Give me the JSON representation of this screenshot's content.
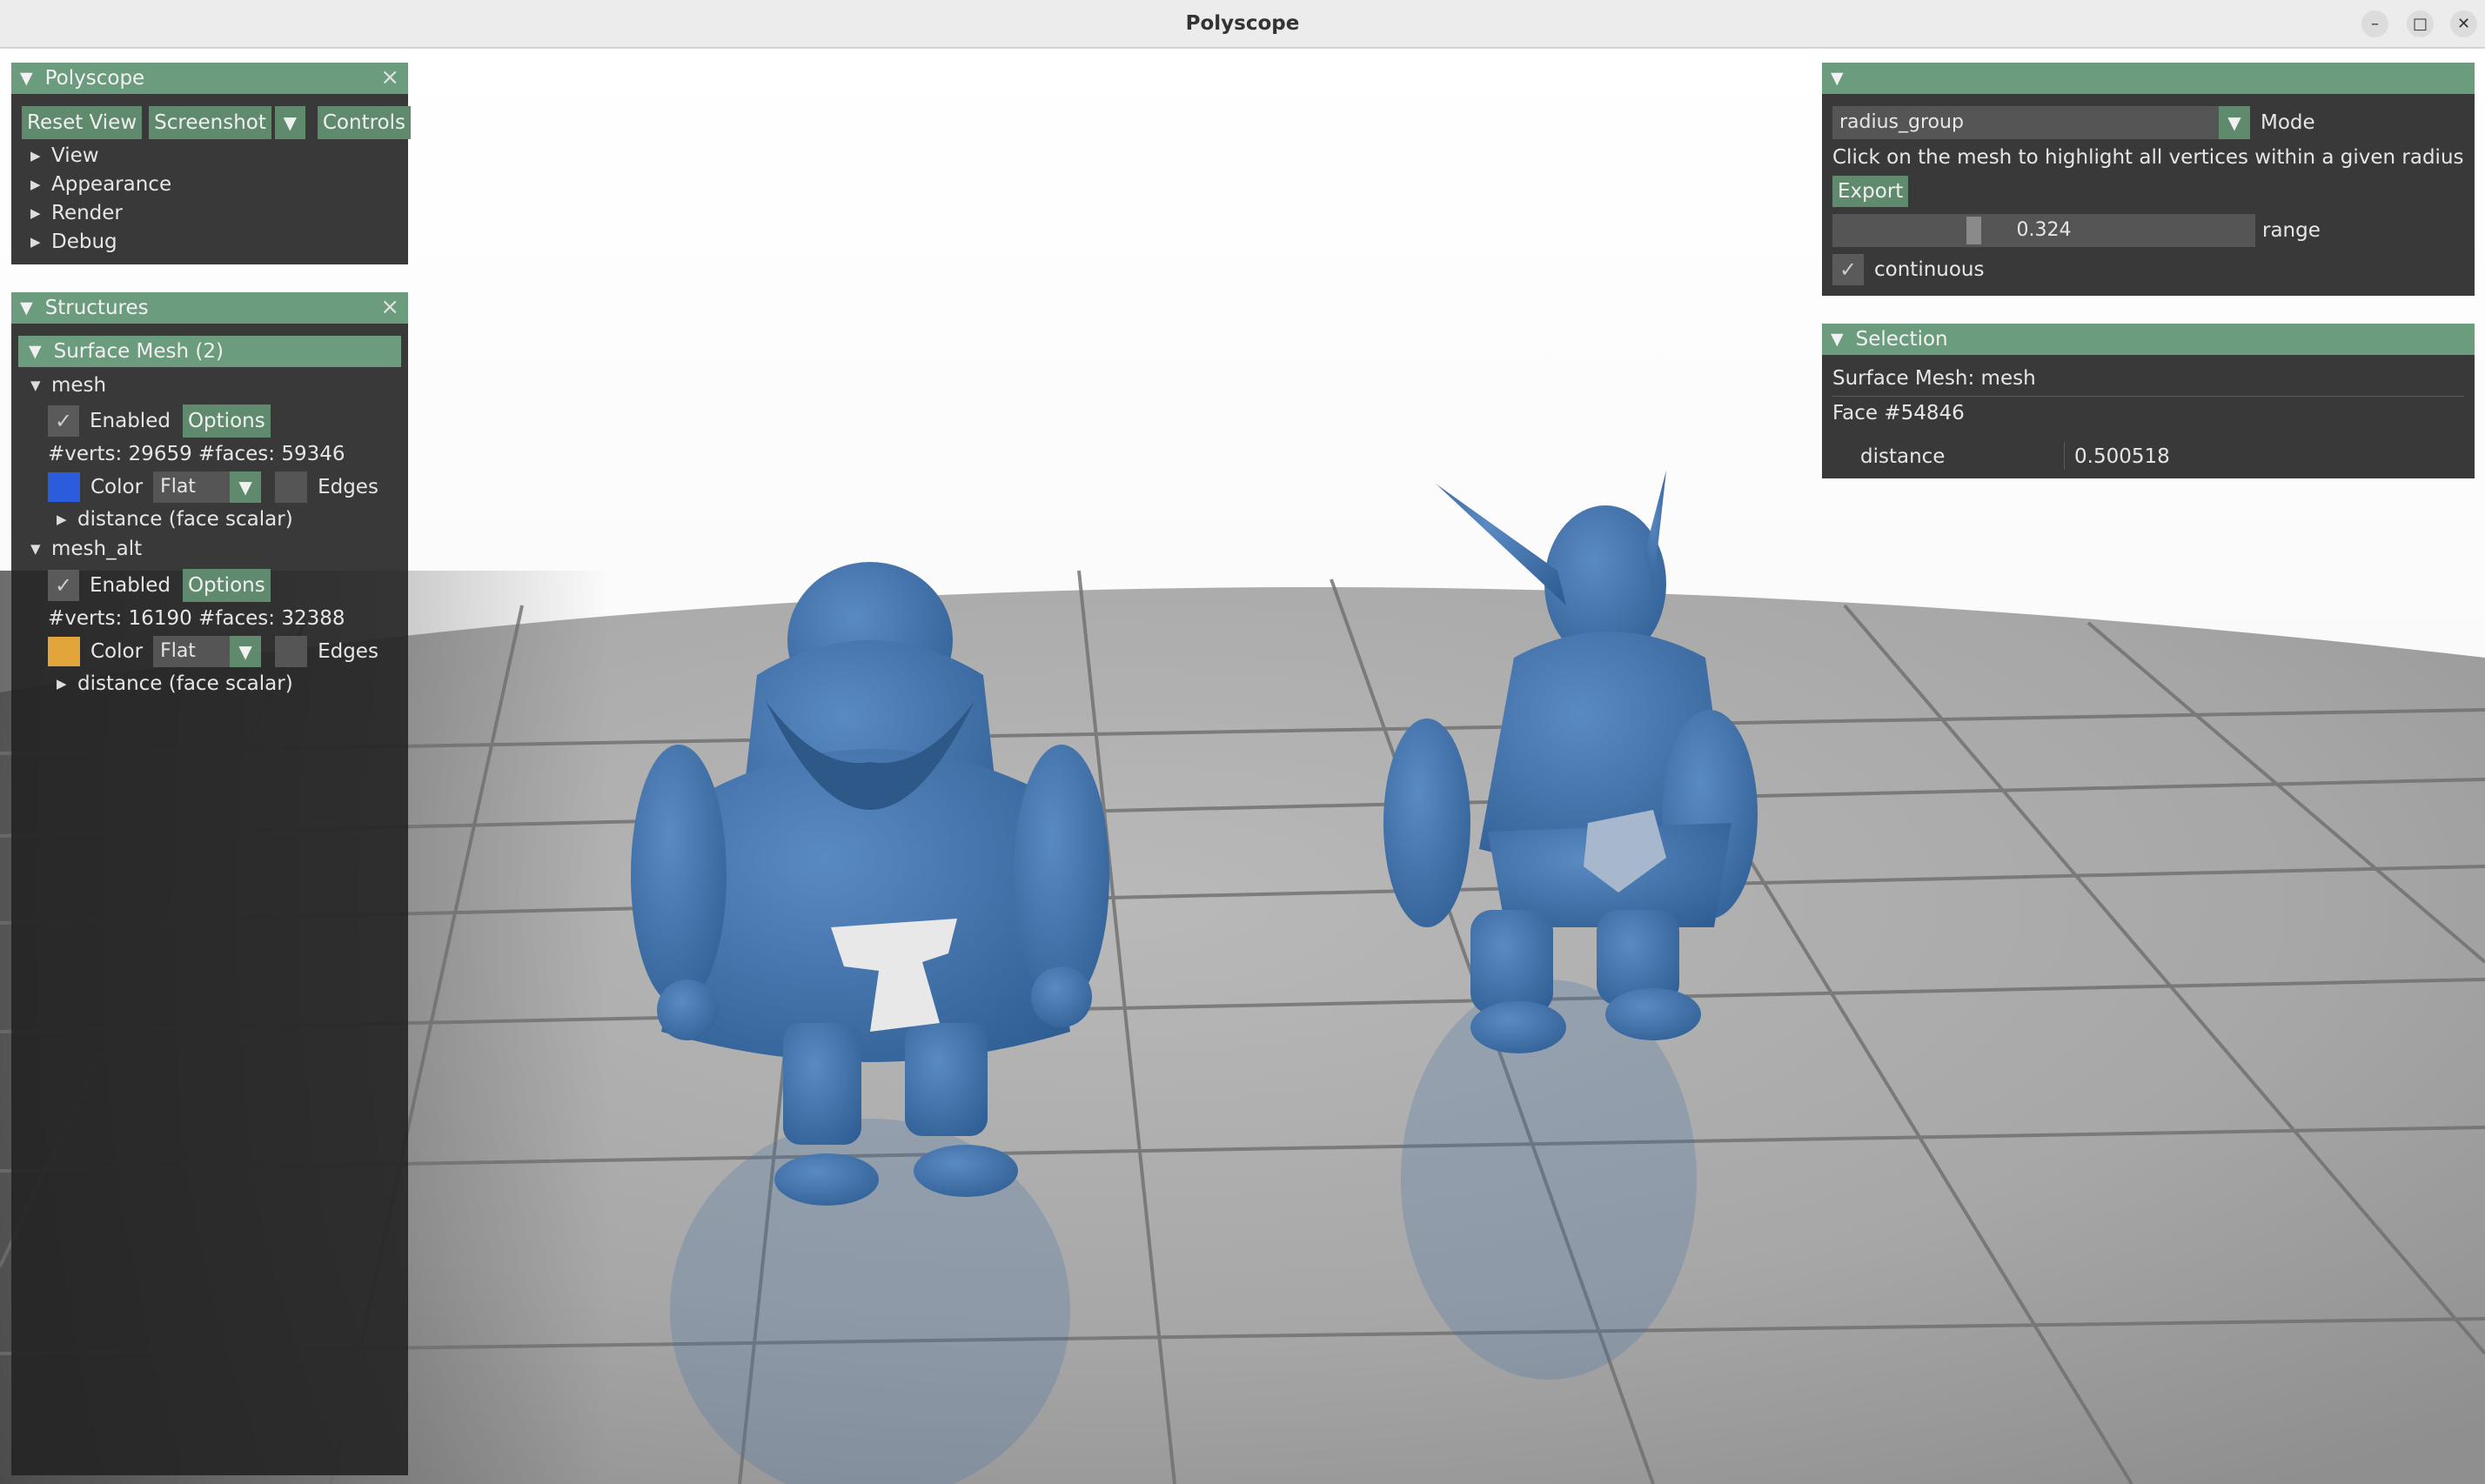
{
  "window": {
    "title": "Polyscope",
    "controls": {
      "minimize": "–",
      "maximize": "□",
      "close": "✕"
    }
  },
  "polyscope_panel": {
    "title": "Polyscope",
    "buttons": {
      "reset_view": "Reset View",
      "screenshot": "Screenshot",
      "controls": "Controls"
    },
    "menu": [
      "View",
      "Appearance",
      "Render",
      "Debug"
    ]
  },
  "structures_panel": {
    "title": "Structures",
    "group": "Surface Mesh (2)",
    "meshes": [
      {
        "name": "mesh",
        "enabled_label": "Enabled",
        "options_label": "Options",
        "stats": "#verts: 29659  #faces: 59346",
        "color": "#2a5cdc",
        "color_label": "Color",
        "shade": "Flat",
        "edges_label": "Edges",
        "quantity": "distance (face scalar)"
      },
      {
        "name": "mesh_alt",
        "enabled_label": "Enabled",
        "options_label": "Options",
        "stats": "#verts: 16190  #faces: 32388",
        "color": "#e2a53b",
        "color_label": "Color",
        "shade": "Flat",
        "edges_label": "Edges",
        "quantity": "distance (face scalar)"
      }
    ]
  },
  "tool_panel": {
    "mode_value": "radius_group",
    "mode_label": "Mode",
    "hint": "Click on the mesh to highlight all vertices within a given radius in feature s",
    "export_label": "Export",
    "range_value": "0.324",
    "range_label": "range",
    "continuous_label": "continuous"
  },
  "selection_panel": {
    "title": "Selection",
    "structure": "Surface Mesh: mesh",
    "face": "Face #54846",
    "field_name": "distance",
    "field_value": "0.500518"
  },
  "colors": {
    "mesh_blue": "#3f6ea3",
    "header_green": "#6c9c7e",
    "button_green": "#5f8a6e"
  }
}
